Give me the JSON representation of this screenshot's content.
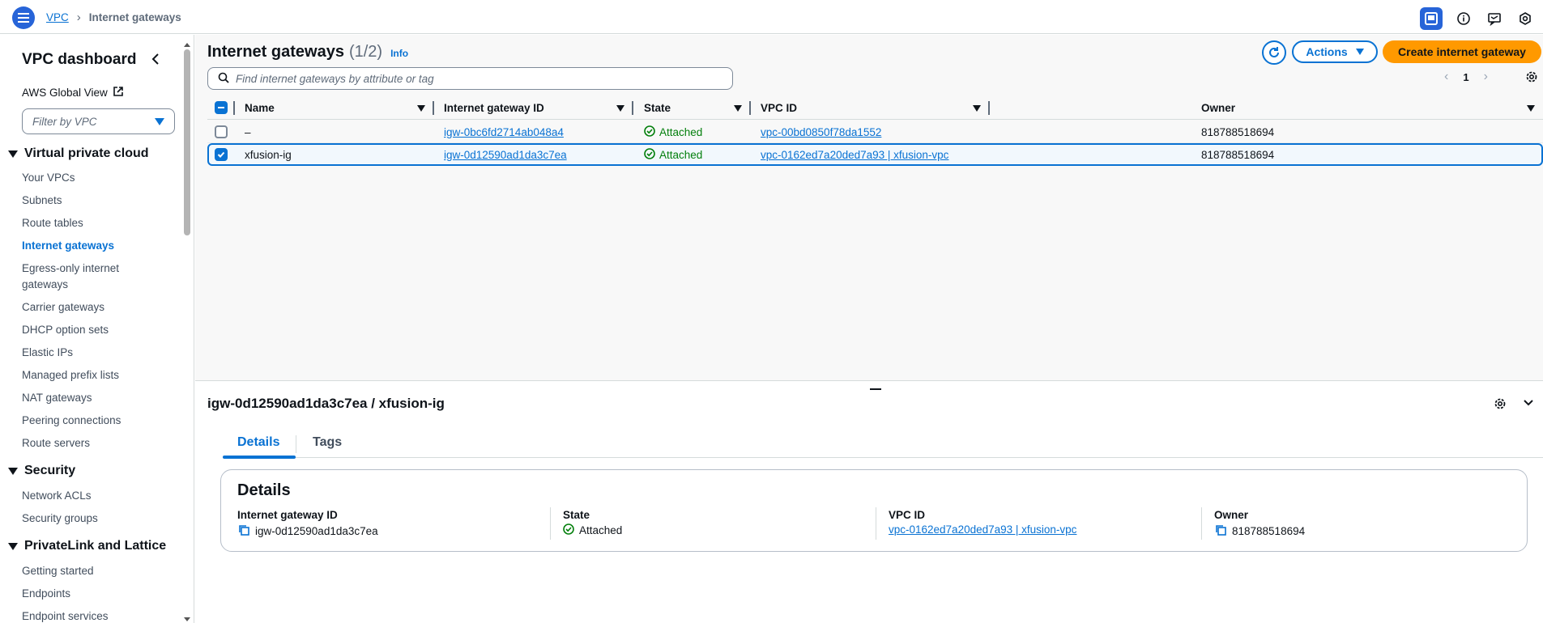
{
  "topbar": {
    "breadcrumb_root": "VPC",
    "breadcrumb_current": "Internet gateways"
  },
  "sidebar": {
    "title": "VPC dashboard",
    "global_view": "AWS Global View",
    "filter_placeholder": "Filter by VPC",
    "sections": [
      {
        "label": "Virtual private cloud"
      },
      {
        "label": "Security"
      },
      {
        "label": "PrivateLink and Lattice"
      }
    ],
    "vpc_items": [
      "Your VPCs",
      "Subnets",
      "Route tables",
      "Internet gateways",
      "Egress-only internet gateways",
      "Carrier gateways",
      "DHCP option sets",
      "Elastic IPs",
      "Managed prefix lists",
      "NAT gateways",
      "Peering connections",
      "Route servers"
    ],
    "security_items": [
      "Network ACLs",
      "Security groups"
    ],
    "privatelink_items": [
      "Getting started",
      "Endpoints",
      "Endpoint services"
    ],
    "active_item": "Internet gateways"
  },
  "main": {
    "title": "Internet gateways",
    "count": "(1/2)",
    "info": "Info",
    "actions_label": "Actions",
    "create_label": "Create internet gateway",
    "search_placeholder": "Find internet gateways by attribute or tag",
    "page_number": "1",
    "columns": [
      "Name",
      "Internet gateway ID",
      "State",
      "VPC ID",
      "Owner"
    ],
    "rows": [
      {
        "name": "–",
        "igw_id": "igw-0bc6fd2714ab048a4",
        "state": "Attached",
        "vpc_id": "vpc-00bd0850f78da1552",
        "owner": "818788518694",
        "selected": false
      },
      {
        "name": "xfusion-ig",
        "igw_id": "igw-0d12590ad1da3c7ea",
        "state": "Attached",
        "vpc_id": "vpc-0162ed7a20ded7a93 | xfusion-vpc",
        "owner": "818788518694",
        "selected": true
      }
    ]
  },
  "details": {
    "title": "igw-0d12590ad1da3c7ea / xfusion-ig",
    "tabs": [
      "Details",
      "Tags"
    ],
    "card_title": "Details",
    "fields": {
      "igw_label": "Internet gateway ID",
      "igw_value": "igw-0d12590ad1da3c7ea",
      "state_label": "State",
      "state_value": "Attached",
      "vpc_label": "VPC ID",
      "vpc_value": "vpc-0162ed7a20ded7a93 | xfusion-vpc",
      "owner_label": "Owner",
      "owner_value": "818788518694"
    }
  },
  "colors": {
    "accent": "#0972d3",
    "create_button": "#ff9900",
    "success": "#037f0c"
  }
}
